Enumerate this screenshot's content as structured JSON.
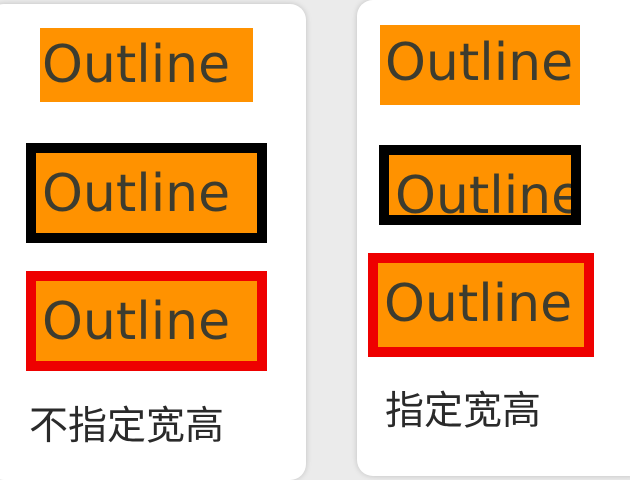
{
  "panels": [
    {
      "caption": "不指定宽高",
      "items": [
        {
          "text": "Outline",
          "border": "none"
        },
        {
          "text": "Outline",
          "border": "#000000"
        },
        {
          "text": "Outline",
          "border": "#ee0000"
        }
      ]
    },
    {
      "caption": "指定宽高",
      "items": [
        {
          "text": "Outline",
          "border": "none"
        },
        {
          "text": "Outline",
          "border": "#000000"
        },
        {
          "text": "Outline",
          "border": "#ee0000"
        }
      ]
    }
  ],
  "colors": {
    "box_background": "#ff9200",
    "text": "#3d3c2f",
    "card_background": "#ffffff",
    "page_background": "#ebebeb"
  }
}
